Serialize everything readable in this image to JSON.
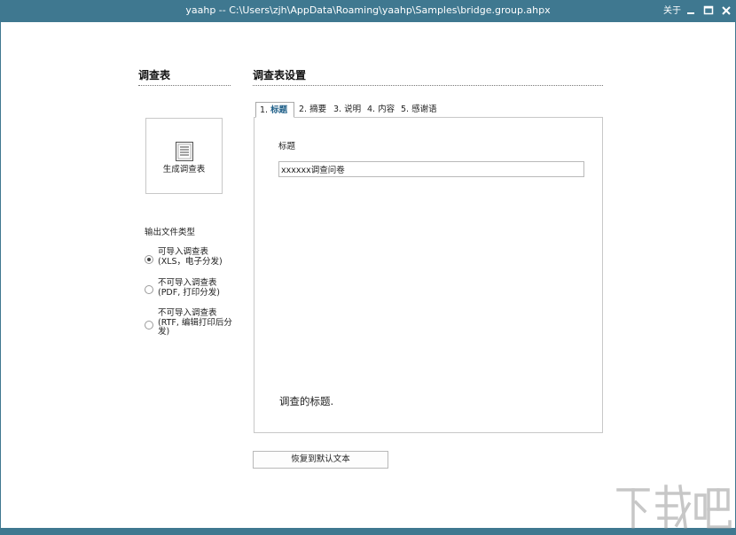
{
  "window": {
    "title": "yaahp -- C:\\Users\\zjh\\AppData\\Roaming\\yaahp\\Samples\\bridge.group.ahpx",
    "about_label": "关于",
    "accent_color": "#3f7890"
  },
  "left": {
    "heading": "调查表",
    "generate_label": "生成调查表",
    "output_type_label": "输出文件类型",
    "options": [
      {
        "line1": "可导入调查表",
        "line2": "(XLS，电子分发)",
        "checked": true
      },
      {
        "line1": "不可导入调查表",
        "line2": "(PDF, 打印分发)",
        "checked": false
      },
      {
        "line1": "不可导入调查表",
        "line2": "(RTF, 编辑打印后分发)",
        "checked": false
      }
    ]
  },
  "right": {
    "heading": "调查表设置",
    "tabs": [
      {
        "num": "1.",
        "label": "标题",
        "active": true
      },
      {
        "num": "2.",
        "label": "摘要",
        "active": false
      },
      {
        "num": "3.",
        "label": "说明",
        "active": false
      },
      {
        "num": "4.",
        "label": "内容",
        "active": false
      },
      {
        "num": "5.",
        "label": "感谢语",
        "active": false
      }
    ],
    "field_label": "标题",
    "field_value": "xxxxxx调查问卷",
    "description": "调查的标题.",
    "restore_label": "恢复到默认文本"
  },
  "watermark_text": "下载吧",
  "icons": {
    "generate": "document-icon",
    "minimize": "minimize-icon",
    "maximize": "maximize-icon",
    "close": "close-icon"
  }
}
